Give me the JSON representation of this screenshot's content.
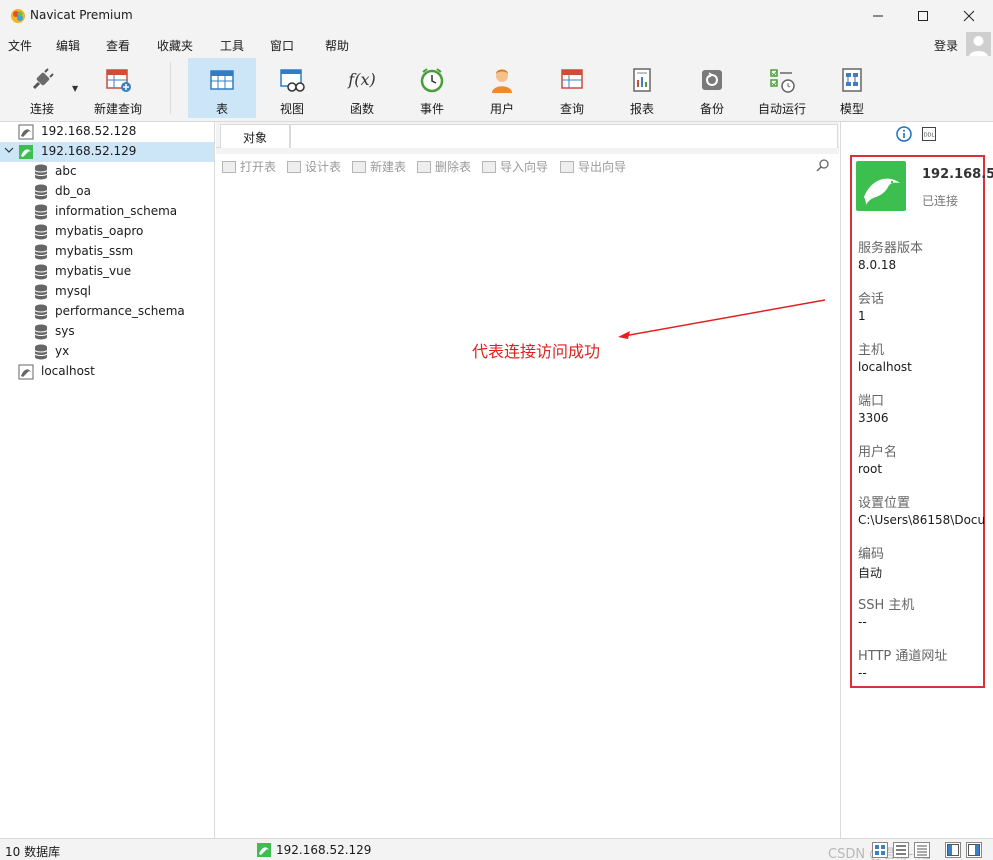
{
  "window": {
    "title": "Navicat Premium"
  },
  "menu": {
    "items": [
      "文件",
      "编辑",
      "查看",
      "收藏夹",
      "工具",
      "窗口",
      "帮助"
    ],
    "login": "登录"
  },
  "toolbar": {
    "buttons": [
      {
        "label": "连接",
        "icon": "plug-icon"
      },
      {
        "label": "新建查询",
        "icon": "new-query-icon"
      },
      {
        "label": "表",
        "icon": "table-icon"
      },
      {
        "label": "视图",
        "icon": "view-icon"
      },
      {
        "label": "函数",
        "icon": "function-icon",
        "glyph": "f(x)"
      },
      {
        "label": "事件",
        "icon": "clock-icon"
      },
      {
        "label": "用户",
        "icon": "user-icon"
      },
      {
        "label": "查询",
        "icon": "query-icon"
      },
      {
        "label": "报表",
        "icon": "report-icon"
      },
      {
        "label": "备份",
        "icon": "backup-icon"
      },
      {
        "label": "自动运行",
        "icon": "schedule-icon"
      },
      {
        "label": "模型",
        "icon": "model-icon"
      }
    ],
    "active": "表"
  },
  "sidebar": {
    "connections": [
      {
        "name": "192.168.52.128",
        "expanded": false
      },
      {
        "name": "192.168.52.129",
        "expanded": true,
        "selected": true,
        "databases": [
          "abc",
          "db_oa",
          "information_schema",
          "mybatis_oapro",
          "mybatis_ssm",
          "mybatis_vue",
          "mysql",
          "performance_schema",
          "sys",
          "yx"
        ]
      },
      {
        "name": "localhost",
        "expanded": false
      }
    ]
  },
  "center": {
    "tab": "对象",
    "object_actions": [
      "打开表",
      "设计表",
      "新建表",
      "删除表",
      "导入向导",
      "导出向导"
    ],
    "annotation": "代表连接访问成功"
  },
  "info": {
    "name": "192.168.5",
    "status": "已连接",
    "fields": [
      {
        "label": "服务器版本",
        "value": "8.0.18"
      },
      {
        "label": "会话",
        "value": "1"
      },
      {
        "label": "主机",
        "value": "localhost"
      },
      {
        "label": "端口",
        "value": "3306"
      },
      {
        "label": "用户名",
        "value": "root"
      },
      {
        "label": "设置位置",
        "value": "C:\\Users\\86158\\Docu"
      },
      {
        "label": "编码",
        "value": "自动"
      },
      {
        "label": "SSH 主机",
        "value": "--"
      },
      {
        "label": "HTTP 通道网址",
        "value": "--"
      }
    ]
  },
  "status": {
    "db_count": "10 数据库",
    "connection": "192.168.52.129",
    "watermark": "CSDN @君易--鑨"
  },
  "colors": {
    "accent": "#cde6f7",
    "highlight_red": "#d9303c",
    "mysql_green": "#3cbf4e"
  }
}
